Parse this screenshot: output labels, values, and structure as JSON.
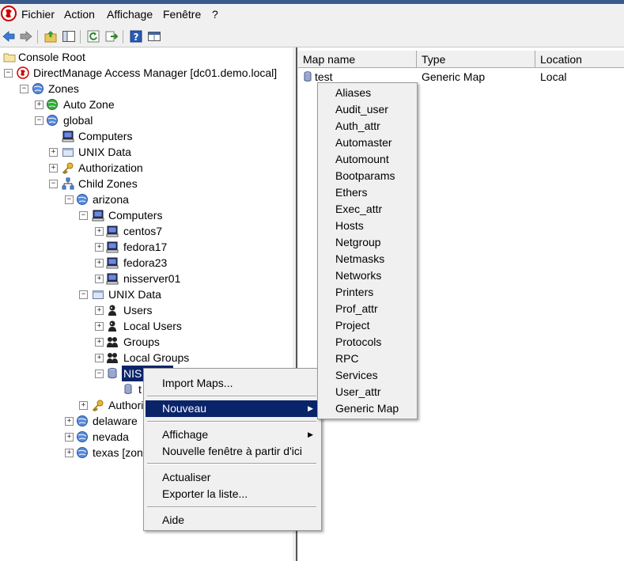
{
  "menubar": {
    "items": [
      "Fichier",
      "Action",
      "Affichage",
      "Fenêtre",
      "?"
    ]
  },
  "toolbar": {
    "icons": [
      "back-icon",
      "forward-icon",
      "up-folder-icon",
      "show-hide-tree-icon",
      "refresh-icon",
      "export-icon",
      "help-icon",
      "properties-icon"
    ]
  },
  "tree": {
    "console_root": "Console Root",
    "manager": "DirectManage Access Manager [dc01.demo.local]",
    "zones": "Zones",
    "auto_zone": "Auto Zone",
    "global": "global",
    "global_computers": "Computers",
    "global_unix_data": "UNIX Data",
    "global_authorization": "Authorization",
    "child_zones": "Child Zones",
    "arizona": "arizona",
    "arizona_computers": "Computers",
    "centos7": "centos7",
    "fedora17": "fedora17",
    "fedora23": "fedora23",
    "nisserver01": "nisserver01",
    "arizona_unix_data": "UNIX Data",
    "users": "Users",
    "local_users": "Local Users",
    "groups": "Groups",
    "local_groups": "Local Groups",
    "nis_maps": "NIS Maps",
    "nis_child": "t",
    "arizona_authorization": "Authori",
    "delaware": "delaware",
    "nevada": "nevada",
    "texas": "texas [zon"
  },
  "list": {
    "columns": [
      "Map name",
      "Type",
      "Location"
    ],
    "rows": [
      {
        "name": "test",
        "type": "Generic Map",
        "location": "Local"
      }
    ]
  },
  "context_menu": {
    "import_maps": "Import Maps...",
    "nouveau": "Nouveau",
    "affichage": "Affichage",
    "nouvelle_fenetre": "Nouvelle fenêtre à partir d'ici",
    "actualiser": "Actualiser",
    "exporter": "Exporter la liste...",
    "aide": "Aide"
  },
  "submenu": {
    "items": [
      "Aliases",
      "Audit_user",
      "Auth_attr",
      "Automaster",
      "Automount",
      "Bootparams",
      "Ethers",
      "Exec_attr",
      "Hosts",
      "Netgroup",
      "Netmasks",
      "Networks",
      "Printers",
      "Prof_attr",
      "Project",
      "Protocols",
      "RPC",
      "Services",
      "User_attr",
      "Generic Map"
    ]
  },
  "colors": {
    "selection": "#0a246a",
    "chrome": "#f0f0f0",
    "title_bar": "#3a5a8c"
  }
}
